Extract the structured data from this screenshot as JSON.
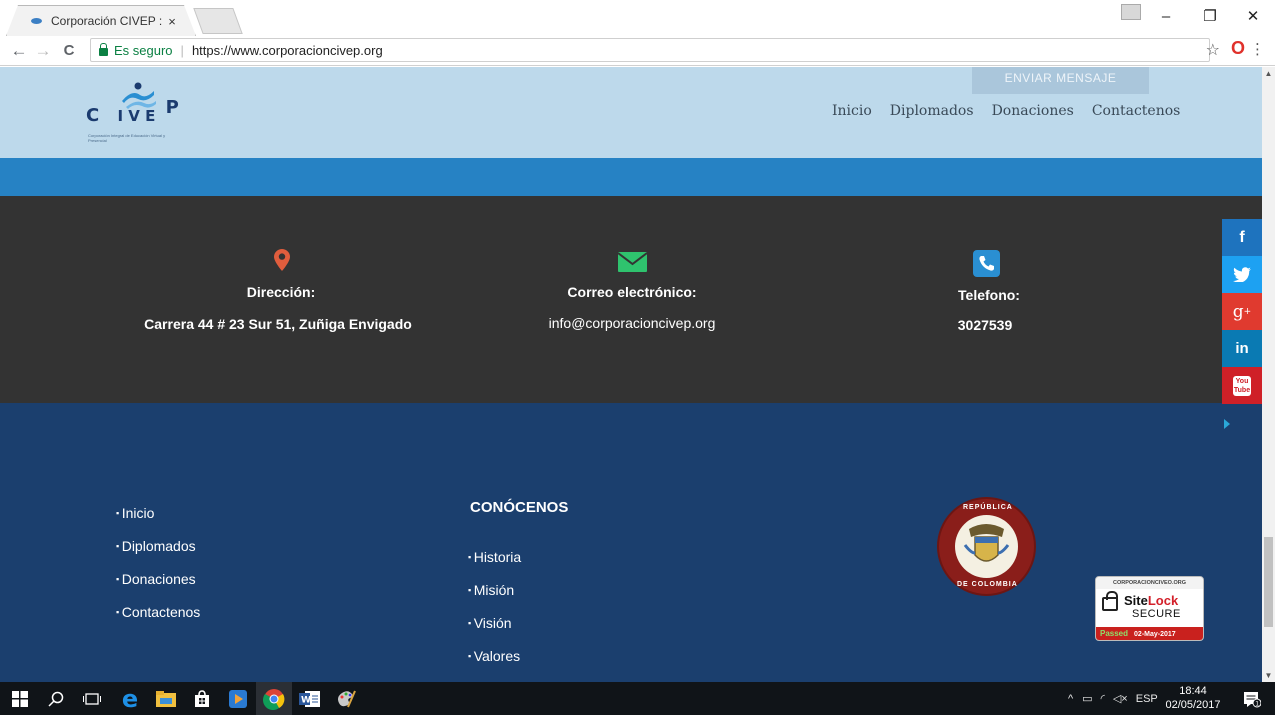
{
  "browser": {
    "tab_title": "Corporación CIVEP : Som",
    "tab_close": "×",
    "secure_label": "Es seguro",
    "url": "https://www.corporacioncivep.org",
    "window_controls": {
      "minimize": "–",
      "restore": "❐",
      "close": "✕"
    },
    "nav": {
      "back": "←",
      "forward": "→",
      "reload": "C"
    },
    "icons": [
      "back-arrow-icon",
      "forward-arrow-icon",
      "reload-icon",
      "lock-icon",
      "star-icon",
      "opera-icon",
      "menu-icon"
    ]
  },
  "header": {
    "send_message_button": "ENVIAR MENSAJE",
    "logo": {
      "letters_left": "C",
      "letters_mid": "I V E",
      "letters_right": "P",
      "tagline": "Corporación Integral de Educación Virtual y Presencial"
    },
    "nav": [
      "Inicio",
      "Diplomados",
      "Donaciones",
      "Contactenos"
    ]
  },
  "contact": {
    "address": {
      "icon": "map-pin-icon",
      "label": "Dirección:",
      "value": "Carrera 44 # 23 Sur 51, Zuñiga Envigado"
    },
    "email": {
      "icon": "envelope-icon",
      "label": "Correo electrónico:",
      "value": "info@corporacioncivep.org"
    },
    "phone": {
      "icon": "phone-icon",
      "label": "Telefono:",
      "value": "3027539"
    }
  },
  "footer": {
    "links": [
      "Inicio",
      "Diplomados",
      "Donaciones",
      "Contactenos"
    ],
    "about_heading": "CONÓCENOS",
    "about_links": [
      "Historia",
      "Misión",
      "Visión",
      "Valores"
    ],
    "seal": {
      "top_text": "REPÚBLICA",
      "bottom_text": "DE COLOMBIA"
    },
    "sitelock": {
      "domain": "CORPORACIONCIVEO.ORG",
      "brand_a": "Site",
      "brand_b": "Lock",
      "secure": "SECURE",
      "passed": "Passed",
      "date": "02-May-2017"
    }
  },
  "social": [
    {
      "label": "f",
      "color": "#1e73be",
      "icon": "facebook-icon"
    },
    {
      "label": "🐦",
      "color": "#1da1f2",
      "icon": "twitter-icon"
    },
    {
      "label": "g+",
      "color": "#e03a2f",
      "icon": "google-plus-icon"
    },
    {
      "label": "in",
      "color": "#0a7ab3",
      "icon": "linkedin-icon"
    },
    {
      "label": "You Tube",
      "color": "#cf2027",
      "icon": "youtube-icon"
    }
  ],
  "taskbar": {
    "lang": "ESP",
    "time": "18:44",
    "date": "02/05/2017",
    "notification_count": "1"
  },
  "colors": {
    "header_bg": "#bdd9eb",
    "blue_band": "#2682c4",
    "contact_bg": "#333333",
    "footer_bg": "#1b3f6e",
    "pin": "#e05d3d",
    "envelope": "#2fc36e",
    "phone": "#2a8fd2"
  }
}
